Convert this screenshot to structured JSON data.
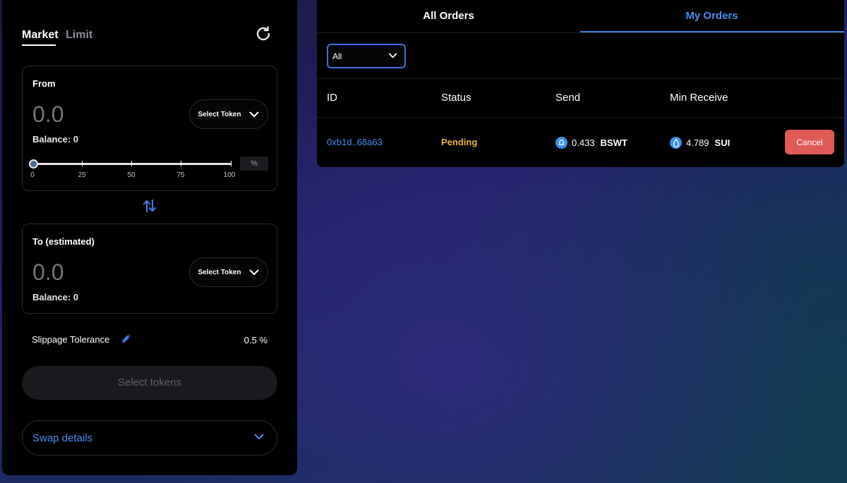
{
  "swap": {
    "tabs": [
      "Market",
      "Limit"
    ],
    "from": {
      "label": "From",
      "amount_placeholder": "0.0",
      "select_token_label": "Select Token",
      "balance": "Balance: 0",
      "slider_value_percent": 0,
      "slider_ticks": [
        "0",
        "25",
        "50",
        "75",
        "100"
      ],
      "percent_unit": "%"
    },
    "to": {
      "label": "To (estimated)",
      "amount_placeholder": "0.0",
      "select_token_label": "Select Token",
      "balance": "Balance: 0"
    },
    "slippage": {
      "label": "Slippage Tolerance",
      "value": "0.5 %"
    },
    "action_button": "Select tokens",
    "swap_details": "Swap details"
  },
  "orders": {
    "tabs": {
      "all": "All Orders",
      "mine": "My Orders"
    },
    "active_tab": "My Orders",
    "filter": {
      "selected": "All"
    },
    "columns": [
      "ID",
      "Status",
      "Send",
      "Min Receive"
    ],
    "rows": [
      {
        "id": "0xb1d..68a63",
        "status": "Pending",
        "send_amount": "0.433",
        "send_symbol": "BSWT",
        "send_icon": "bswt-token-icon",
        "receive_amount": "4.789",
        "receive_symbol": "SUI",
        "receive_icon": "sui-token-icon",
        "action": "Cancel"
      }
    ]
  },
  "colors": {
    "accent": "#4a8ef0",
    "pending": "#e8b44a",
    "cancel": "#de5b57",
    "panel": "#000000"
  }
}
